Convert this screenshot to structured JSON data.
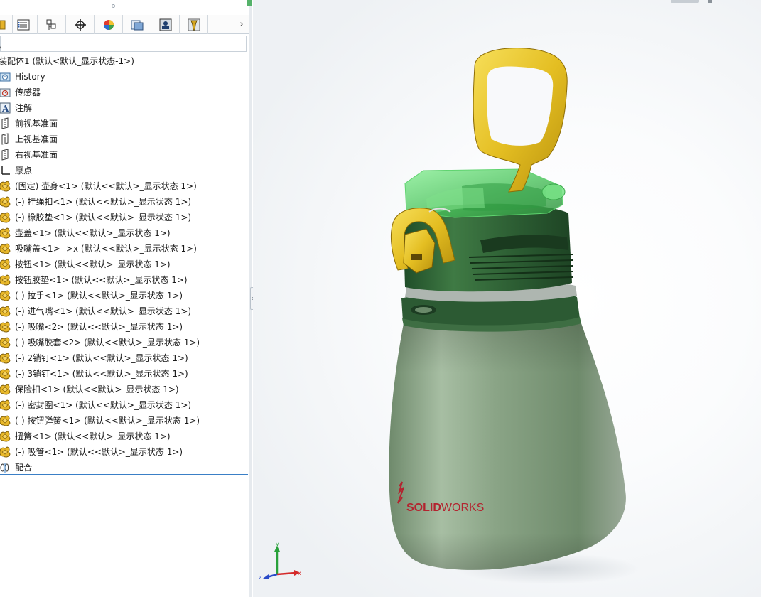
{
  "feature_tree": {
    "root_label": "装配体1  (默认<默认_显示状态-1>)",
    "items": [
      {
        "label": "History",
        "icon": "history-icon"
      },
      {
        "label": "传感器",
        "icon": "sensor-icon"
      },
      {
        "label": "注解",
        "icon": "annotation-icon"
      },
      {
        "label": "前视基准面",
        "icon": "plane-icon"
      },
      {
        "label": "上视基准面",
        "icon": "plane-icon"
      },
      {
        "label": "右视基准面",
        "icon": "plane-icon"
      },
      {
        "label": "原点",
        "icon": "origin-icon"
      },
      {
        "label": "(固定) 壶身<1> (默认<<默认>_显示状态 1>)",
        "icon": "part-icon"
      },
      {
        "label": "(-) 挂绳扣<1> (默认<<默认>_显示状态 1>)",
        "icon": "part-icon"
      },
      {
        "label": "(-) 橡胶垫<1> (默认<<默认>_显示状态 1>)",
        "icon": "part-icon"
      },
      {
        "label": "壶盖<1> (默认<<默认>_显示状态 1>)",
        "icon": "part-icon"
      },
      {
        "label": "吸嘴盖<1> ->x (默认<<默认>_显示状态 1>)",
        "icon": "part-icon"
      },
      {
        "label": "按钮<1> (默认<<默认>_显示状态 1>)",
        "icon": "part-icon"
      },
      {
        "label": "按钮胶垫<1> (默认<<默认>_显示状态 1>)",
        "icon": "part-icon"
      },
      {
        "label": "(-) 拉手<1> (默认<<默认>_显示状态 1>)",
        "icon": "part-icon"
      },
      {
        "label": "(-) 进气嘴<1> (默认<<默认>_显示状态 1>)",
        "icon": "part-icon"
      },
      {
        "label": "(-) 吸嘴<2> (默认<<默认>_显示状态 1>)",
        "icon": "part-icon"
      },
      {
        "label": "(-) 吸嘴胶套<2> (默认<<默认>_显示状态 1>)",
        "icon": "part-icon"
      },
      {
        "label": "(-) 2销钉<1> (默认<<默认>_显示状态 1>)",
        "icon": "part-icon"
      },
      {
        "label": "(-) 3销钉<1> (默认<<默认>_显示状态 1>)",
        "icon": "part-icon"
      },
      {
        "label": "保险扣<1> (默认<<默认>_显示状态 1>)",
        "icon": "part-icon"
      },
      {
        "label": "(-) 密封圈<1> (默认<<默认>_显示状态 1>)",
        "icon": "part-icon"
      },
      {
        "label": "(-) 按钮弹簧<1> (默认<<默认>_显示状态 1>)",
        "icon": "part-icon"
      },
      {
        "label": "扭簧<1> (默认<<默认>_显示状态 1>)",
        "icon": "part-icon"
      },
      {
        "label": "(-) 吸管<1> (默认<<默认>_显示状态 1>)",
        "icon": "part-icon"
      },
      {
        "label": "配合",
        "icon": "mates-icon"
      }
    ]
  },
  "panel_tabs": [
    {
      "icon": "feature-manager-icon"
    },
    {
      "icon": "property-manager-icon"
    },
    {
      "icon": "configuration-manager-icon"
    },
    {
      "icon": "dimxpert-icon"
    },
    {
      "icon": "appearance-icon"
    },
    {
      "icon": "cam-icon"
    },
    {
      "icon": "display-manager-icon"
    },
    {
      "icon": "tool-icon"
    }
  ],
  "filter": {
    "value": "",
    "placeholder": ""
  },
  "viewport": {
    "logo_brand_bold": "SOLID",
    "logo_brand_light": "WORKS",
    "triad_axes": [
      "x",
      "y",
      "z"
    ]
  },
  "colors": {
    "bottle_green": "#7d9878",
    "lid_green": "#2f6b3a",
    "transparent_green": "#49c85a",
    "handle_yellow": "#e3bd24",
    "logo_red": "#b3242f",
    "selection_blue": "#3a7fc6"
  }
}
